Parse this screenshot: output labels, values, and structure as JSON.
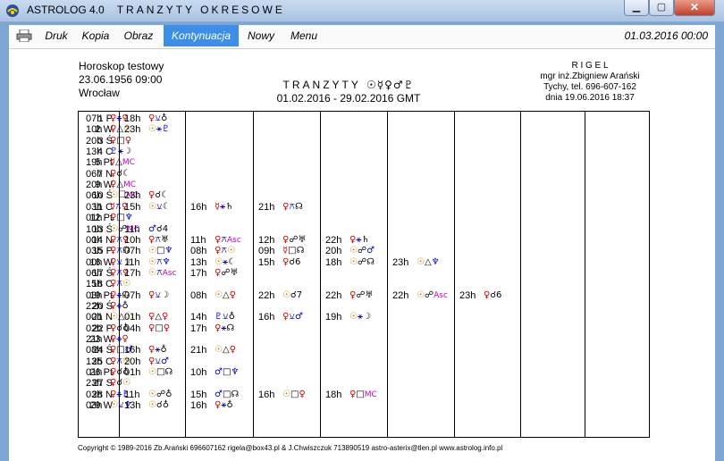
{
  "window": {
    "app_name": "ASTROLOG 4.0",
    "app_subtitle": "TRANZYTY OKRESOWE"
  },
  "menu": {
    "items": [
      "Druk",
      "Kopia",
      "Obraz",
      "Kontynuacja",
      "Nowy",
      "Menu"
    ],
    "active": "Kontynuacja",
    "date": "01.03.2016  00:00"
  },
  "header": {
    "chart_name": "Horoskop testowy",
    "birth": "23.06.1956  09:00",
    "place": "Wrocław",
    "title": "TRANZYTY",
    "title_glyphs": "☉☿♀♂♇",
    "period": "01.02.2016 - 29.02.2016  GMT",
    "org": "R I G E L",
    "author": "mgr inż.Zbigniew Arański",
    "contact": "Tychy, tel. 696-607-162",
    "printed": "dnia 19.06.2016  18:37"
  },
  "rows": [
    {
      "day": "1 P",
      "e": [
        [
          "07h",
          "♀⚹♀"
        ],
        [
          "18h",
          "♀⚺♁"
        ]
      ]
    },
    {
      "day": "2 W",
      "e": [
        [
          "10h",
          "♀△☉"
        ],
        [
          "23h",
          "☉⚹♇"
        ]
      ]
    },
    {
      "day": "3 Ś",
      "e": [
        [
          "20h",
          "♀□♀"
        ]
      ]
    },
    {
      "day": "4 C",
      "e": [
        [
          "13h",
          "♇⚹☽"
        ]
      ]
    },
    {
      "day": "5 Pt",
      "e": [
        [
          "19h",
          "☿△MC"
        ]
      ]
    },
    {
      "day": "7 N",
      "e": [
        [
          "06h",
          "♀☌☾"
        ]
      ]
    },
    {
      "day": "9 W",
      "e": [
        [
          "20h",
          "♀△MC"
        ]
      ]
    },
    {
      "day": "10 Ś",
      "e": [
        [
          "06h",
          "☉☐MC"
        ],
        [
          "23h",
          "♀☌☾"
        ]
      ]
    },
    {
      "day": "11 C",
      "e": [
        [
          "03h",
          "☿⚻♀"
        ],
        [
          "15h",
          "☉⚺☾"
        ],
        [
          "16h",
          "☿⚹♄"
        ],
        [
          "21h",
          "♀⚻☊"
        ]
      ]
    },
    {
      "day": "12 Pt",
      "e": [
        [
          "01h",
          "♀□♆"
        ]
      ]
    },
    {
      "day": "13 Ś",
      "e": [
        [
          "10h",
          "☉☍MC"
        ],
        [
          "11h",
          "♂☌4"
        ]
      ]
    },
    {
      "day": "14 N",
      "e": [
        [
          "00h",
          "♀⚻♀"
        ],
        [
          "10h",
          "♀⚻♅"
        ],
        [
          "11h",
          "♀⚻Asc"
        ],
        [
          "12h",
          "♀☍♅"
        ],
        [
          "22h",
          "♀⚹♄"
        ]
      ]
    },
    {
      "day": "15 P",
      "e": [
        [
          "03h",
          "♀⚻☊"
        ],
        [
          "07h",
          "☉□♆"
        ],
        [
          "08h",
          "♀⚻☉"
        ],
        [
          "09h",
          "☿□☊"
        ],
        [
          "20h",
          "☉☍♂"
        ]
      ]
    },
    {
      "day": "16 W",
      "e": [
        [
          "00h",
          "♀⚺☽"
        ],
        [
          "11h",
          "☉⚻♆"
        ],
        [
          "13h",
          "☉⚹☾"
        ],
        [
          "15h",
          "♀☌6"
        ],
        [
          "18h",
          "☉☍☊"
        ],
        [
          "23h",
          "☉△♆"
        ]
      ]
    },
    {
      "day": "17 Ś",
      "e": [
        [
          "06h",
          "♀⚻♀"
        ],
        [
          "17h",
          "☉⚻Asc"
        ],
        [
          "17h",
          "♀☍♅"
        ]
      ]
    },
    {
      "day": "18 C",
      "e": [
        [
          "15h",
          "♀⚻☉"
        ]
      ]
    },
    {
      "day": "19 Pt",
      "e": [
        [
          "03h",
          "♀⚹☊"
        ],
        [
          "07h",
          "♀⚺☽"
        ],
        [
          "08h",
          "☉△♀"
        ],
        [
          "22h",
          "☉☌7"
        ],
        [
          "22h",
          "♀☍♅"
        ],
        [
          "22h",
          "☉☍Asc"
        ],
        [
          "23h",
          "♀☌6"
        ]
      ]
    },
    {
      "day": "20 Ś",
      "e": [
        [
          "22h",
          "♀⚹♁"
        ]
      ]
    },
    {
      "day": "21 N",
      "e": [
        [
          "00h",
          "☉△☉"
        ],
        [
          "01h",
          "♀△♀"
        ],
        [
          "14h",
          "♇⚺♁"
        ],
        [
          "16h",
          "♀⚺♂"
        ],
        [
          "19h",
          "☉⚹☽"
        ]
      ]
    },
    {
      "day": "22 P",
      "e": [
        [
          "02h",
          "♀☌♁"
        ],
        [
          "04h",
          "♀□♀"
        ],
        [
          "17h",
          "♀⚹☊"
        ]
      ]
    },
    {
      "day": "23 W",
      "e": [
        [
          "21h",
          "♀⚹♀"
        ]
      ]
    },
    {
      "day": "24 Ś",
      "e": [
        [
          "08h",
          "♀□♂"
        ],
        [
          "16h",
          "♀⚹♁"
        ],
        [
          "21h",
          "☉△♀"
        ]
      ]
    },
    {
      "day": "25 C",
      "e": [
        [
          "13h",
          "♀⚻☉"
        ],
        [
          "20h",
          "♀⚺♂"
        ]
      ]
    },
    {
      "day": "26 Pt",
      "e": [
        [
          "01h",
          "♀☌♁"
        ],
        [
          "01h",
          "☉□☊"
        ],
        [
          "10h",
          "♂□♆"
        ]
      ]
    },
    {
      "day": "27 S",
      "e": [
        [
          "23h",
          "♀☌☉"
        ]
      ]
    },
    {
      "day": "28 N",
      "e": [
        [
          "03h",
          "♀⚹♇"
        ],
        [
          "11h",
          "☉☍♁"
        ],
        [
          "15h",
          "♂□☊"
        ],
        [
          "16h",
          "☉□♀"
        ],
        [
          "18h",
          "♀□MC"
        ]
      ]
    },
    {
      "day": "29 W",
      "e": [
        [
          "03h",
          "☉⚺♆"
        ],
        [
          "13h",
          "☉☌♁"
        ],
        [
          "16h",
          "♀⚹♁"
        ]
      ]
    }
  ],
  "footer": {
    "copyright": "Copyright © 1989-2016 Zb.Arański 696607162 rigela@box43.pl & J.Chwiszczuk 713890519 astro-asterix@tlen.pl  www.astrolog.info.pl"
  }
}
